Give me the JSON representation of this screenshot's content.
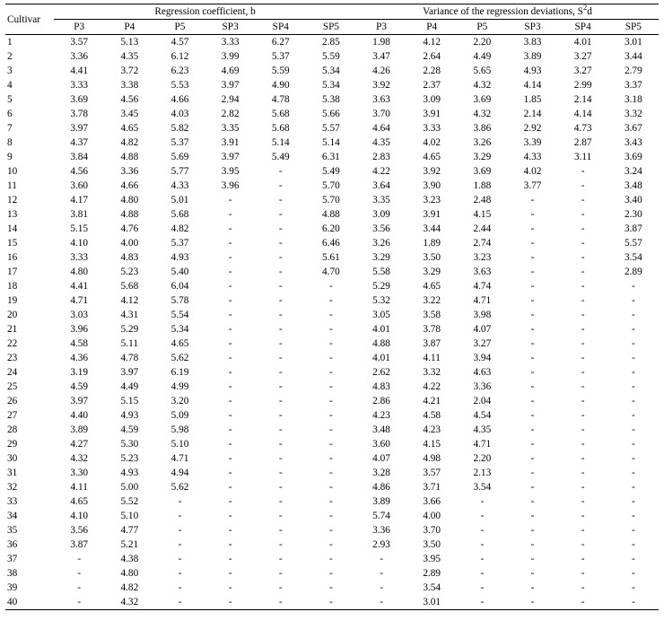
{
  "headers": {
    "cultivar": "Cultivar",
    "group_b": "Regression coefficient, b",
    "group_s2d_pre": "Variance of the regression deviations, S",
    "group_s2d_sup": "2",
    "group_s2d_post": "d",
    "sub": [
      "P3",
      "P4",
      "P5",
      "SP3",
      "SP4",
      "SP5",
      "P3",
      "P4",
      "P5",
      "SP3",
      "SP4",
      "SP5"
    ]
  },
  "chart_data": {
    "type": "table",
    "columns": [
      "Cultivar",
      "b_P3",
      "b_P4",
      "b_P5",
      "b_SP3",
      "b_SP4",
      "b_SP5",
      "s2d_P3",
      "s2d_P4",
      "s2d_P5",
      "s2d_SP3",
      "s2d_SP4",
      "s2d_SP5"
    ],
    "rows": [
      {
        "c": "1",
        "v": [
          "3.57",
          "5.13",
          "4.57",
          "3.33",
          "6.27",
          "2.85",
          "1.98",
          "4.12",
          "2.20",
          "3.83",
          "4.01",
          "3.01"
        ]
      },
      {
        "c": "2",
        "v": [
          "3.36",
          "4.35",
          "6.12",
          "3.99",
          "5.37",
          "5.59",
          "3.47",
          "2.64",
          "4.49",
          "3.89",
          "3.27",
          "3.44"
        ]
      },
      {
        "c": "3",
        "v": [
          "4.41",
          "3.72",
          "6.23",
          "4.69",
          "5.59",
          "5.34",
          "4.26",
          "2.28",
          "5.65",
          "4.93",
          "3.27",
          "2.79"
        ]
      },
      {
        "c": "4",
        "v": [
          "3.33",
          "3.38",
          "5.53",
          "3.97",
          "4.90",
          "5.34",
          "3.92",
          "2.37",
          "4.32",
          "4.14",
          "2.99",
          "3.37"
        ]
      },
      {
        "c": "5",
        "v": [
          "3.69",
          "4.56",
          "4.66",
          "2.94",
          "4.78",
          "5.38",
          "3.63",
          "3.09",
          "3.69",
          "1.85",
          "2.14",
          "3.18"
        ]
      },
      {
        "c": "6",
        "v": [
          "3.78",
          "3.45",
          "4.03",
          "2.82",
          "5.68",
          "5.66",
          "3.70",
          "3.91",
          "4.32",
          "2.14",
          "4.14",
          "3.32"
        ]
      },
      {
        "c": "7",
        "v": [
          "3.97",
          "4.65",
          "5.82",
          "3.35",
          "5.68",
          "5.57",
          "4.64",
          "3.33",
          "3.86",
          "2.92",
          "4.73",
          "3.67"
        ]
      },
      {
        "c": "8",
        "v": [
          "4.37",
          "4.82",
          "5.37",
          "3.91",
          "5.14",
          "5.14",
          "4.35",
          "4.02",
          "3.26",
          "3.39",
          "2.87",
          "3.43"
        ]
      },
      {
        "c": "9",
        "v": [
          "3.84",
          "4.88",
          "5.69",
          "3.97",
          "5.49",
          "6.31",
          "2.83",
          "4.65",
          "3.29",
          "4.33",
          "3.11",
          "3.69"
        ]
      },
      {
        "c": "10",
        "v": [
          "4.56",
          "3.36",
          "5.77",
          "3.95",
          "-",
          "5.49",
          "4.22",
          "3.92",
          "3.69",
          "4.02",
          "-",
          "3.24"
        ]
      },
      {
        "c": "11",
        "v": [
          "3.60",
          "4.66",
          "4.33",
          "3.96",
          "-",
          "5.70",
          "3.64",
          "3.90",
          "1.88",
          "3.77",
          "-",
          "3.48"
        ]
      },
      {
        "c": "12",
        "v": [
          "4.17",
          "4.80",
          "5.01",
          "-",
          "-",
          "5.70",
          "3.35",
          "3.23",
          "2.48",
          "-",
          "-",
          "3.40"
        ]
      },
      {
        "c": "13",
        "v": [
          "3.81",
          "4.88",
          "5.68",
          "-",
          "-",
          "4.88",
          "3.09",
          "3.91",
          "4.15",
          "-",
          "-",
          "2.30"
        ]
      },
      {
        "c": "14",
        "v": [
          "5.15",
          "4.76",
          "4.82",
          "-",
          "-",
          "6.20",
          "3.56",
          "3.44",
          "2.44",
          "-",
          "-",
          "3.87"
        ]
      },
      {
        "c": "15",
        "v": [
          "4.10",
          "4.00",
          "5.37",
          "-",
          "-",
          "6.46",
          "3.26",
          "1.89",
          "2.74",
          "-",
          "-",
          "5.57"
        ]
      },
      {
        "c": "16",
        "v": [
          "3.33",
          "4.83",
          "4.93",
          "-",
          "-",
          "5.61",
          "3.29",
          "3.50",
          "3.23",
          "-",
          "-",
          "3.54"
        ]
      },
      {
        "c": "17",
        "v": [
          "4.80",
          "5.23",
          "5.40",
          "-",
          "-",
          "4.70",
          "5.58",
          "3.29",
          "3.63",
          "-",
          "-",
          "2.89"
        ]
      },
      {
        "c": "18",
        "v": [
          "4.41",
          "5.68",
          "6.04",
          "-",
          "-",
          "-",
          "5.29",
          "4.65",
          "4.74",
          "-",
          "-",
          "-"
        ]
      },
      {
        "c": "19",
        "v": [
          "4.71",
          "4.12",
          "5.78",
          "-",
          "-",
          "-",
          "5.32",
          "3.22",
          "4.71",
          "-",
          "-",
          "-"
        ]
      },
      {
        "c": "20",
        "v": [
          "3.03",
          "4.31",
          "5.54",
          "-",
          "-",
          "-",
          "3.05",
          "3.58",
          "3.98",
          "-",
          "-",
          "-"
        ]
      },
      {
        "c": "21",
        "v": [
          "3.96",
          "5.29",
          "5.34",
          "-",
          "-",
          "-",
          "4.01",
          "3.78",
          "4.07",
          "-",
          "-",
          "-"
        ]
      },
      {
        "c": "22",
        "v": [
          "4.58",
          "5.11",
          "4.65",
          "-",
          "-",
          "-",
          "4.88",
          "3.87",
          "3.27",
          "-",
          "-",
          "-"
        ]
      },
      {
        "c": "23",
        "v": [
          "4.36",
          "4.78",
          "5.62",
          "-",
          "-",
          "-",
          "4.01",
          "4.11",
          "3.94",
          "-",
          "-",
          "-"
        ]
      },
      {
        "c": "24",
        "v": [
          "3.19",
          "3.97",
          "6.19",
          "-",
          "-",
          "-",
          "2.62",
          "3.32",
          "4.63",
          "-",
          "-",
          "-"
        ]
      },
      {
        "c": "25",
        "v": [
          "4.59",
          "4.49",
          "4.99",
          "-",
          "-",
          "-",
          "4.83",
          "4.22",
          "3.36",
          "-",
          "-",
          "-"
        ]
      },
      {
        "c": "26",
        "v": [
          "3.97",
          "5.15",
          "3.20",
          "-",
          "-",
          "-",
          "2.86",
          "4.21",
          "2.04",
          "-",
          "-",
          "-"
        ]
      },
      {
        "c": "27",
        "v": [
          "4.40",
          "4.93",
          "5.09",
          "-",
          "-",
          "-",
          "4.23",
          "4.58",
          "4.54",
          "-",
          "-",
          "-"
        ]
      },
      {
        "c": "28",
        "v": [
          "3.89",
          "4.59",
          "5.98",
          "-",
          "-",
          "-",
          "3.48",
          "4.23",
          "4.35",
          "-",
          "-",
          "-"
        ]
      },
      {
        "c": "29",
        "v": [
          "4.27",
          "5.30",
          "5.10",
          "-",
          "-",
          "-",
          "3.60",
          "4.15",
          "4.71",
          "-",
          "-",
          "-"
        ]
      },
      {
        "c": "30",
        "v": [
          "4.32",
          "5.23",
          "4.71",
          "-",
          "-",
          "-",
          "4.07",
          "4.98",
          "2.20",
          "-",
          "-",
          "-"
        ]
      },
      {
        "c": "31",
        "v": [
          "3.30",
          "4.93",
          "4.94",
          "-",
          "-",
          "-",
          "3.28",
          "3.57",
          "2.13",
          "-",
          "-",
          "-"
        ]
      },
      {
        "c": "32",
        "v": [
          "4.11",
          "5.00",
          "5.62",
          "-",
          "-",
          "-",
          "4.86",
          "3.71",
          "3.54",
          "-",
          "-",
          "-"
        ]
      },
      {
        "c": "33",
        "v": [
          "4.65",
          "5.52",
          "-",
          "-",
          "-",
          "-",
          "3.89",
          "3.66",
          "-",
          "-",
          "-",
          "-"
        ]
      },
      {
        "c": "34",
        "v": [
          "4.10",
          "5.10",
          "-",
          "-",
          "-",
          "-",
          "5.74",
          "4.00",
          "-",
          "-",
          "-",
          "-"
        ]
      },
      {
        "c": "35",
        "v": [
          "3.56",
          "4.77",
          "-",
          "-",
          "-",
          "-",
          "3.36",
          "3.70",
          "-",
          "-",
          "-",
          "-"
        ]
      },
      {
        "c": "36",
        "v": [
          "3.87",
          "5.21",
          "-",
          "-",
          "-",
          "-",
          "2.93",
          "3.50",
          "-",
          "-",
          "-",
          "-"
        ]
      },
      {
        "c": "37",
        "v": [
          "-",
          "4.38",
          "-",
          "-",
          "-",
          "-",
          "-",
          "3.95",
          "-",
          "-",
          "-",
          "-"
        ]
      },
      {
        "c": "38",
        "v": [
          "-",
          "4.80",
          "-",
          "-",
          "-",
          "-",
          "-",
          "2.89",
          "-",
          "-",
          "-",
          "-"
        ]
      },
      {
        "c": "39",
        "v": [
          "-",
          "4.82",
          "-",
          "-",
          "-",
          "-",
          "-",
          "3.54",
          "-",
          "-",
          "-",
          "-"
        ]
      },
      {
        "c": "40",
        "v": [
          "-",
          "4.32",
          "-",
          "-",
          "-",
          "-",
          "-",
          "3.01",
          "-",
          "-",
          "-",
          "-"
        ]
      }
    ]
  }
}
